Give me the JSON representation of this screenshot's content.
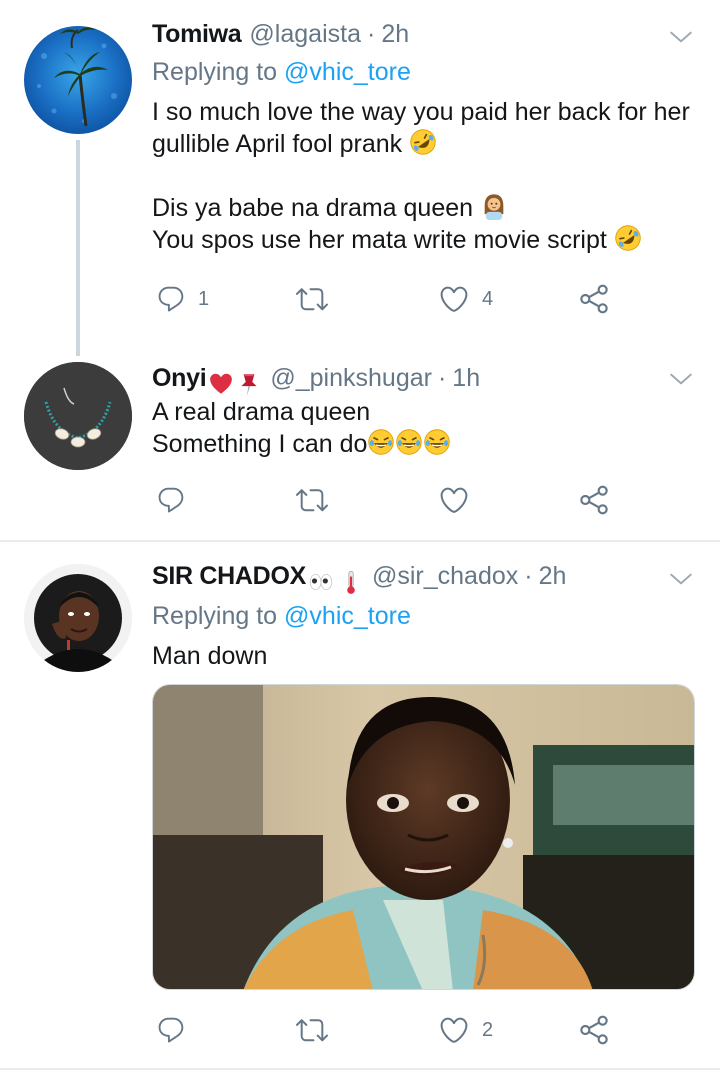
{
  "tweets": [
    {
      "name": "Tomiwa",
      "handle": "@lagaista",
      "dot": "·",
      "time": "2h",
      "replying_prefix": "Replying to",
      "replying_to": "@vhic_tore",
      "lines": [
        "I so much love the way you paid her back for her",
        "gullible April fool prank",
        "Dis ya babe na drama queen",
        "You spos use her mata write movie script"
      ],
      "reply_count": "1",
      "retweet_count": "",
      "like_count": "4"
    },
    {
      "name": "Onyi",
      "handle": "@_pinkshugar",
      "dot": "·",
      "time": "1h",
      "lines": [
        "A real drama queen",
        "Something I can do"
      ],
      "reply_count": "",
      "retweet_count": "",
      "like_count": ""
    },
    {
      "name": "SIR CHADOX",
      "handle": "@sir_chadox",
      "dot": "·",
      "time": "2h",
      "replying_prefix": "Replying to",
      "replying_to": "@vhic_tore",
      "lines": [
        "Man down"
      ],
      "reply_count": "",
      "retweet_count": "",
      "like_count": "2"
    }
  ],
  "colors": {
    "text": "#14171a",
    "secondary": "#657786",
    "link": "#1da1f2",
    "divider": "#e6ecf0",
    "thread_line": "#ccd6dd"
  },
  "icons": [
    "reply-icon",
    "retweet-icon",
    "like-icon",
    "share-icon",
    "chevron-down-icon"
  ]
}
